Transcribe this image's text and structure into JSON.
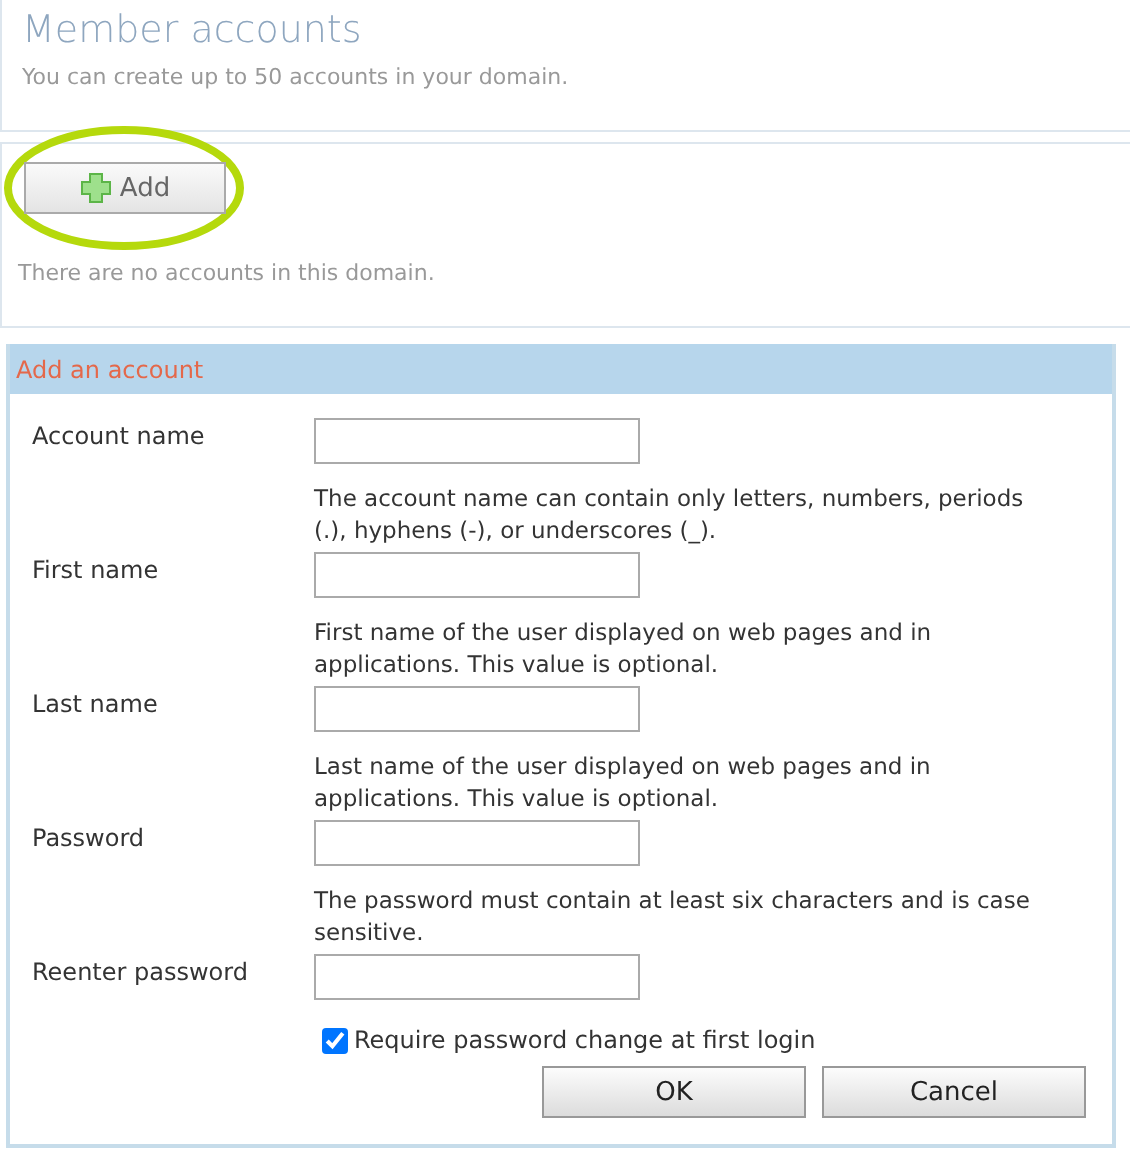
{
  "page": {
    "title": "Member accounts",
    "subtitle": "You can create up to 50 accounts in your domain."
  },
  "add_button": {
    "label": "Add"
  },
  "empty_message": "There are no accounts in this domain.",
  "dialog": {
    "title": "Add an account",
    "fields": [
      {
        "label": "Account name",
        "hint": "The account name can contain only letters, numbers, periods (.), hyphens (-), or underscores (_)."
      },
      {
        "label": "First name",
        "hint": "First name of the user displayed on web pages and in applications. This value is optional."
      },
      {
        "label": "Last name",
        "hint": "Last name of the user displayed on web pages and in applications. This value is optional."
      },
      {
        "label": "Password",
        "hint": "The password must contain at least six characters and is case sensitive."
      },
      {
        "label": "Reenter password"
      }
    ],
    "checkbox": {
      "label": "Require password change at first login",
      "checked": true
    },
    "buttons": [
      "OK",
      "Cancel"
    ]
  }
}
